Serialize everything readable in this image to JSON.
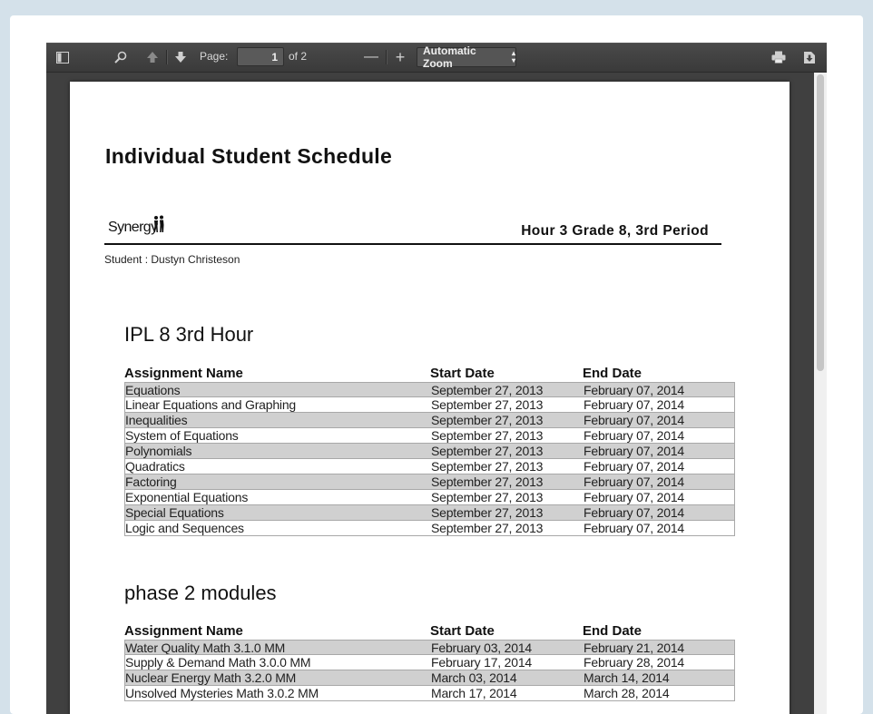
{
  "toolbar": {
    "page_label": "Page:",
    "page_value": "1",
    "page_of": "of 2",
    "zoom_label": "Automatic Zoom",
    "icons": [
      "sidebar-toggle-icon",
      "search-icon",
      "previous-page-icon",
      "next-page-icon",
      "zoom-out-icon",
      "zoom-in-icon",
      "print-icon",
      "download-icon"
    ]
  },
  "document": {
    "title": "Individual Student Schedule",
    "logo_text": "Synergy",
    "hour_label": "Hour 3 Grade 8, 3rd Period",
    "student": "Student : Dustyn Christeson",
    "sections": [
      {
        "title": "IPL 8 3rd Hour",
        "headers": [
          "Assignment Name",
          "Start Date",
          "End Date"
        ],
        "rows": [
          [
            "Equations",
            "September 27, 2013",
            "February 07, 2014"
          ],
          [
            "Linear Equations and Graphing",
            "September 27, 2013",
            "February 07, 2014"
          ],
          [
            "Inequalities",
            "September 27, 2013",
            "February 07, 2014"
          ],
          [
            "System of Equations",
            "September 27, 2013",
            "February 07, 2014"
          ],
          [
            "Polynomials",
            "September 27, 2013",
            "February 07, 2014"
          ],
          [
            "Quadratics",
            "September 27, 2013",
            "February 07, 2014"
          ],
          [
            "Factoring",
            "September 27, 2013",
            "February 07, 2014"
          ],
          [
            "Exponential Equations",
            "September 27, 2013",
            "February 07, 2014"
          ],
          [
            "Special Equations",
            "September 27, 2013",
            "February 07, 2014"
          ],
          [
            "Logic and Sequences",
            "September 27, 2013",
            "February 07, 2014"
          ]
        ]
      },
      {
        "title": "phase 2 modules",
        "headers": [
          "Assignment Name",
          "Start Date",
          "End Date"
        ],
        "rows": [
          [
            "Water Quality Math 3.1.0 MM",
            "February 03, 2014",
            "February 21, 2014"
          ],
          [
            "Supply & Demand Math 3.0.0 MM",
            "February 17, 2014",
            "February 28, 2014"
          ],
          [
            "Nuclear Energy Math 3.2.0 MM",
            "March 03, 2014",
            "March 14, 2014"
          ],
          [
            "Unsolved Mysteries Math 3.0.2 MM",
            "March 17, 2014",
            "March 28, 2014"
          ]
        ]
      }
    ]
  }
}
